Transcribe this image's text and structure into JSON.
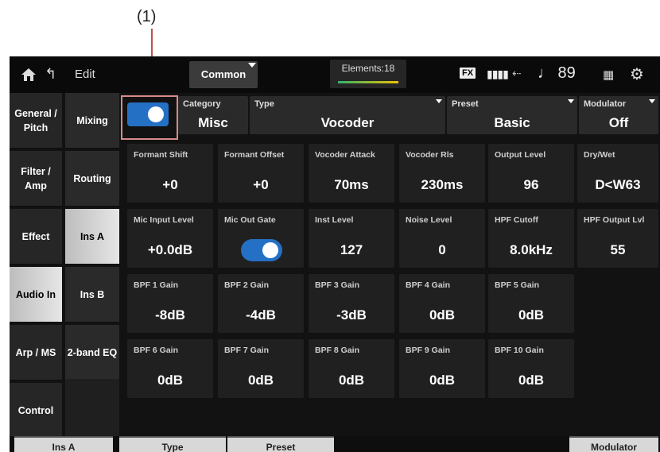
{
  "callout": {
    "label": "(1)"
  },
  "topbar": {
    "edit": "Edit",
    "common": "Common",
    "elements": "Elements:18",
    "fx": "FX",
    "tempo": "♩ 89"
  },
  "left_nav": [
    {
      "label": "General / Pitch"
    },
    {
      "label": "Filter / Amp"
    },
    {
      "label": "Effect"
    },
    {
      "label": "Audio In",
      "selected": true
    },
    {
      "label": "Arp / MS"
    },
    {
      "label": "Control"
    }
  ],
  "sub_nav": [
    {
      "label": "Mixing"
    },
    {
      "label": "Routing"
    },
    {
      "label": "Ins A",
      "selected": true
    },
    {
      "label": "Ins B"
    },
    {
      "label": "2-band EQ"
    }
  ],
  "header": {
    "switch_on": true,
    "category": {
      "label": "Category",
      "value": "Misc"
    },
    "type": {
      "label": "Type",
      "value": "Vocoder"
    },
    "preset": {
      "label": "Preset",
      "value": "Basic"
    },
    "modulator": {
      "label": "Modulator",
      "value": "Off"
    }
  },
  "params": {
    "formant_shift": {
      "label": "Formant Shift",
      "value": "+0"
    },
    "formant_offset": {
      "label": "Formant Offset",
      "value": "+0"
    },
    "vocoder_attack": {
      "label": "Vocoder Attack",
      "value": "70ms"
    },
    "vocoder_rls": {
      "label": "Vocoder Rls",
      "value": "230ms"
    },
    "output_level": {
      "label": "Output Level",
      "value": "96"
    },
    "dry_wet": {
      "label": "Dry/Wet",
      "value": "D<W63"
    },
    "mic_input_level": {
      "label": "Mic Input Level",
      "value": "+0.0dB"
    },
    "mic_out_gate": {
      "label": "Mic Out Gate",
      "on": true
    },
    "inst_level": {
      "label": "Inst Level",
      "value": "127"
    },
    "noise_level": {
      "label": "Noise Level",
      "value": "0"
    },
    "hpf_cutoff": {
      "label": "HPF Cutoff",
      "value": "8.0kHz"
    },
    "hpf_output_lvl": {
      "label": "HPF Output Lvl",
      "value": "55"
    },
    "bpf1": {
      "label": "BPF 1 Gain",
      "value": "-8dB"
    },
    "bpf2": {
      "label": "BPF 2 Gain",
      "value": "-4dB"
    },
    "bpf3": {
      "label": "BPF 3 Gain",
      "value": "-3dB"
    },
    "bpf4": {
      "label": "BPF 4 Gain",
      "value": "0dB"
    },
    "bpf5": {
      "label": "BPF 5 Gain",
      "value": "0dB"
    },
    "bpf6": {
      "label": "BPF 6 Gain",
      "value": "0dB"
    },
    "bpf7": {
      "label": "BPF 7 Gain",
      "value": "0dB"
    },
    "bpf8": {
      "label": "BPF 8 Gain",
      "value": "0dB"
    },
    "bpf9": {
      "label": "BPF 9 Gain",
      "value": "0dB"
    },
    "bpf10": {
      "label": "BPF 10 Gain",
      "value": "0dB"
    }
  },
  "bottom_tabs": {
    "ins_a": "Ins A",
    "type": "Type",
    "preset": "Preset",
    "modulator": "Modulator"
  },
  "colors": {
    "accent": "#2470c4",
    "highlight": "#d98a8a",
    "callout_line": "#c0504d"
  }
}
